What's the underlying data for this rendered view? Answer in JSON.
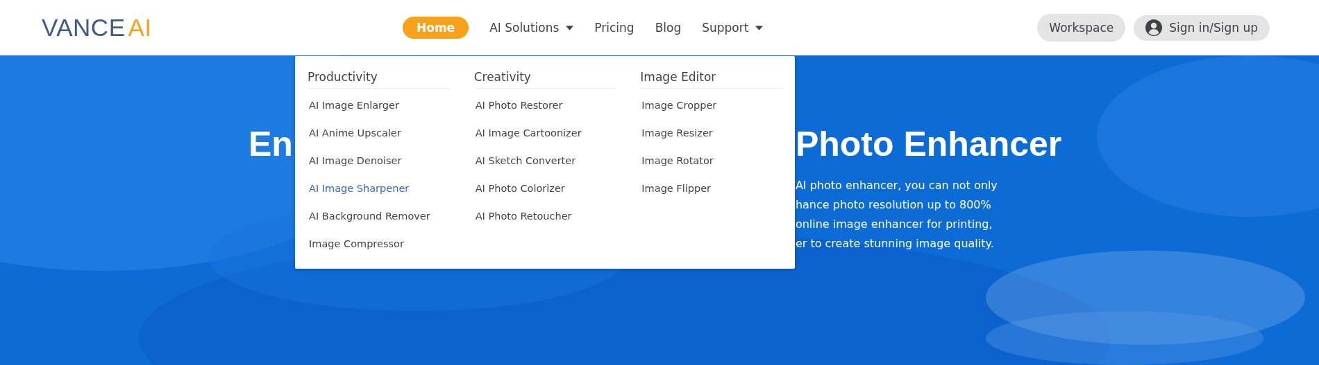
{
  "header": {
    "logo": {
      "first": "VANCE",
      "second": "AI"
    },
    "nav": [
      {
        "label": "Home",
        "selected": true,
        "has_caret": false
      },
      {
        "label": "AI Solutions",
        "selected": false,
        "has_caret": true
      },
      {
        "label": "Pricing",
        "selected": false,
        "has_caret": false
      },
      {
        "label": "Blog",
        "selected": false,
        "has_caret": false
      },
      {
        "label": "Support",
        "selected": false,
        "has_caret": true
      }
    ],
    "workspace_button": "Workspace",
    "sign_in_button": "Sign in/Sign up"
  },
  "hero": {
    "background": {
      "kind": "picture"
    },
    "title_left": "En",
    "title_right": "Photo Enhancer",
    "text_lines": [
      "AI photo enhancer, you can not only",
      "hance photo resolution up to 800%",
      "online image enhancer for printing,",
      "er to create stunning image quality."
    ]
  },
  "dropdown": {
    "columns": [
      {
        "heading": "Productivity",
        "items": [
          {
            "label": "AI Image Enlarger",
            "hovered": false
          },
          {
            "label": "AI Anime Upscaler",
            "hovered": false
          },
          {
            "label": "AI Image Denoiser",
            "hovered": false
          },
          {
            "label": "AI Image Sharpener",
            "hovered": true
          },
          {
            "label": "AI Background Remover",
            "hovered": false
          },
          {
            "label": "Image Compressor",
            "hovered": false
          }
        ]
      },
      {
        "heading": "Creativity",
        "items": [
          {
            "label": "AI Photo Restorer",
            "hovered": false
          },
          {
            "label": "AI Image Cartoonizer",
            "hovered": false
          },
          {
            "label": "AI Sketch Converter",
            "hovered": false
          },
          {
            "label": "AI Photo Colorizer",
            "hovered": false
          },
          {
            "label": "AI Photo Retoucher",
            "hovered": false
          }
        ]
      },
      {
        "heading": "Image Editor",
        "items": [
          {
            "label": "Image Cropper",
            "hovered": false
          },
          {
            "label": "Image Resizer",
            "hovered": false
          },
          {
            "label": "Image Rotator",
            "hovered": false
          },
          {
            "label": "Image Flipper",
            "hovered": false
          }
        ]
      }
    ]
  }
}
